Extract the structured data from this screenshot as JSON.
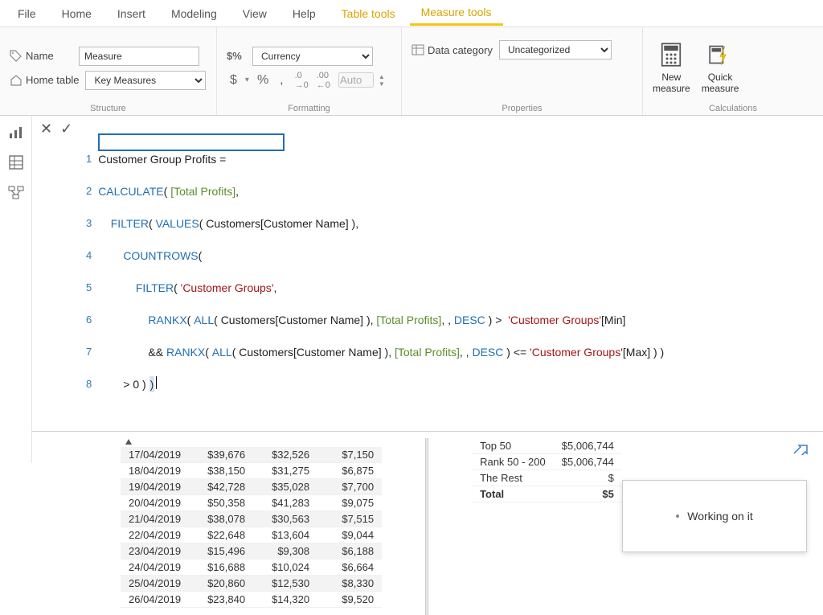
{
  "menu": {
    "file": "File",
    "home": "Home",
    "insert": "Insert",
    "modeling": "Modeling",
    "view": "View",
    "help": "Help",
    "table_tools": "Table tools",
    "measure_tools": "Measure tools"
  },
  "ribbon": {
    "structure": {
      "name_label": "Name",
      "name_value": "Measure",
      "home_table_label": "Home table",
      "home_table_value": "Key Measures",
      "group_label": "Structure"
    },
    "formatting": {
      "format_label_prefix": "$%",
      "format_value": "Currency",
      "dollar": "$",
      "percent": "%",
      "comma": ",",
      "dec1": ".0",
      "dec2": ".00",
      "auto": "Auto",
      "group_label": "Formatting"
    },
    "properties": {
      "data_category_label": "Data category",
      "data_category_value": "Uncategorized",
      "group_label": "Properties"
    },
    "calculations": {
      "new_measure": "New\nmeasure",
      "quick_measure": "Quick\nmeasure",
      "group_label": "Calculations"
    }
  },
  "formula": {
    "lines": [
      {
        "n": "1",
        "plain": "Customer Group Profits ="
      },
      {
        "n": "2",
        "kw": "CALCULATE",
        "rest": "( ",
        "field": "[Total Profits]",
        "tail": ","
      },
      {
        "n": "3",
        "indent": "    ",
        "kw": "FILTER",
        "rest": "( ",
        "kw2": "VALUES",
        "rest2": "( Customers[Customer Name] ),"
      },
      {
        "n": "4",
        "indent": "        ",
        "kw": "COUNTROWS",
        "rest": "("
      },
      {
        "n": "5",
        "indent": "            ",
        "kw": "FILTER",
        "rest": "( ",
        "str": "'Customer Groups'",
        "tail": ","
      },
      {
        "n": "6",
        "indent": "                ",
        "kw": "RANKX",
        "rest": "( ",
        "kw2": "ALL",
        "rest2": "( Customers[Customer Name] ), ",
        "field": "[Total Profits]",
        "mid": ", , ",
        "kw3": "DESC",
        "tail": " ) >  ",
        "str": "'Customer Groups'",
        "tail2": "[Min]"
      },
      {
        "n": "7",
        "indent": "                && ",
        "kw": "RANKX",
        "rest": "( ",
        "kw2": "ALL",
        "rest2": "( Customers[Customer Name] ), ",
        "field": "[Total Profits]",
        "mid": ", , ",
        "kw3": "DESC",
        "tail": " ) <= ",
        "str": "'Customer Groups'",
        "tail2": "[Max] ) )"
      },
      {
        "n": "8",
        "indent": "        > 0 ) ",
        ")": ")"
      }
    ]
  },
  "table_left": {
    "rows": [
      [
        "17/04/2019",
        "$39,676",
        "$32,526",
        "$7,150"
      ],
      [
        "18/04/2019",
        "$38,150",
        "$31,275",
        "$6,875"
      ],
      [
        "19/04/2019",
        "$42,728",
        "$35,028",
        "$7,700"
      ],
      [
        "20/04/2019",
        "$50,358",
        "$41,283",
        "$9,075"
      ],
      [
        "21/04/2019",
        "$38,078",
        "$30,563",
        "$7,515"
      ],
      [
        "22/04/2019",
        "$22,648",
        "$13,604",
        "$9,044"
      ],
      [
        "23/04/2019",
        "$15,496",
        "$9,308",
        "$6,188"
      ],
      [
        "24/04/2019",
        "$16,688",
        "$10,024",
        "$6,664"
      ],
      [
        "25/04/2019",
        "$20,860",
        "$12,530",
        "$8,330"
      ],
      [
        "26/04/2019",
        "$23,840",
        "$14,320",
        "$9,520"
      ]
    ]
  },
  "table_right": {
    "rows": [
      [
        "Top 50",
        "$5,006,744"
      ],
      [
        "Rank 50 - 200",
        "$5,006,744"
      ],
      [
        "The Rest",
        "$"
      ]
    ],
    "total_label": "Total",
    "total_value": "$5"
  },
  "tooltip": {
    "text": "Working on it"
  }
}
